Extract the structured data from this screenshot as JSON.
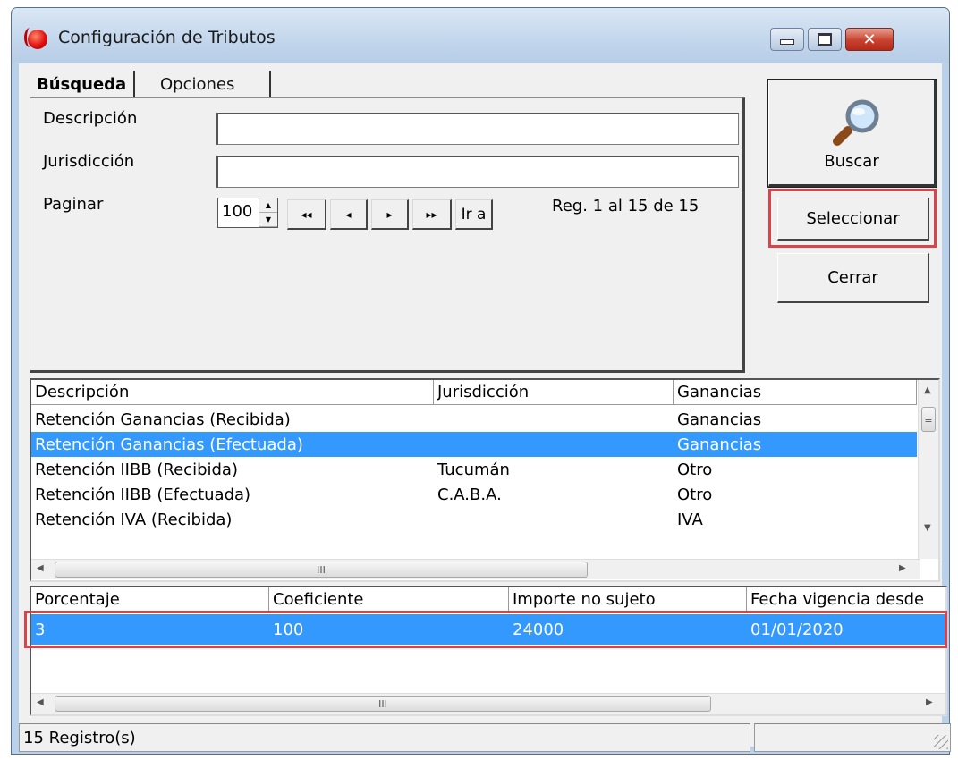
{
  "window": {
    "title": "Configuración de Tributos",
    "controls": {
      "minimize": "minimize-icon",
      "maximize": "maximize-icon",
      "close": "close-icon"
    }
  },
  "tabs": [
    {
      "label": "Búsqueda",
      "active": true
    },
    {
      "label": "Opciones",
      "active": false
    }
  ],
  "search": {
    "descripcion_label": "Descripción",
    "descripcion_value": "",
    "jurisdiccion_label": "Jurisdicción",
    "jurisdiccion_value": "",
    "paginar_label": "Paginar",
    "paginar_value": "100",
    "nav": {
      "first": "◂◂",
      "prev": "◂",
      "next": "▸",
      "last": "▸▸",
      "goto": "Ir a"
    },
    "records_info": "Reg. 1 al 15 de 15"
  },
  "actions": {
    "buscar": "Buscar",
    "seleccionar": "Seleccionar",
    "cerrar": "Cerrar"
  },
  "grid_main": {
    "columns": [
      "Descripción",
      "Jurisdicción",
      "Ganancias"
    ],
    "rows": [
      {
        "descripcion": "Retención Ganancias (Recibida)",
        "jurisdiccion": "",
        "tipo": "Ganancias",
        "selected": false
      },
      {
        "descripcion": "Retención Ganancias (Efectuada)",
        "jurisdiccion": "",
        "tipo": "Ganancias",
        "selected": true
      },
      {
        "descripcion": "Retención IIBB (Recibida)",
        "jurisdiccion": "Tucumán",
        "tipo": "Otro",
        "selected": false
      },
      {
        "descripcion": "Retención IIBB (Efectuada)",
        "jurisdiccion": "C.A.B.A.",
        "tipo": "Otro",
        "selected": false
      },
      {
        "descripcion": "Retención IVA (Recibida)",
        "jurisdiccion": "",
        "tipo": "IVA",
        "selected": false
      }
    ]
  },
  "grid_detail": {
    "columns": [
      "Porcentaje",
      "Coeficiente",
      "Importe no sujeto",
      "Fecha vigencia desde"
    ],
    "rows": [
      {
        "porcentaje": "3",
        "coeficiente": "100",
        "importe": "24000",
        "fecha": "01/01/2020",
        "selected": true
      }
    ]
  },
  "statusbar": {
    "records": "15 Registro(s)"
  },
  "colors": {
    "selection": "#3399ff",
    "highlight_frame": "#d9434a",
    "window_frame": "#b9d1ea"
  }
}
